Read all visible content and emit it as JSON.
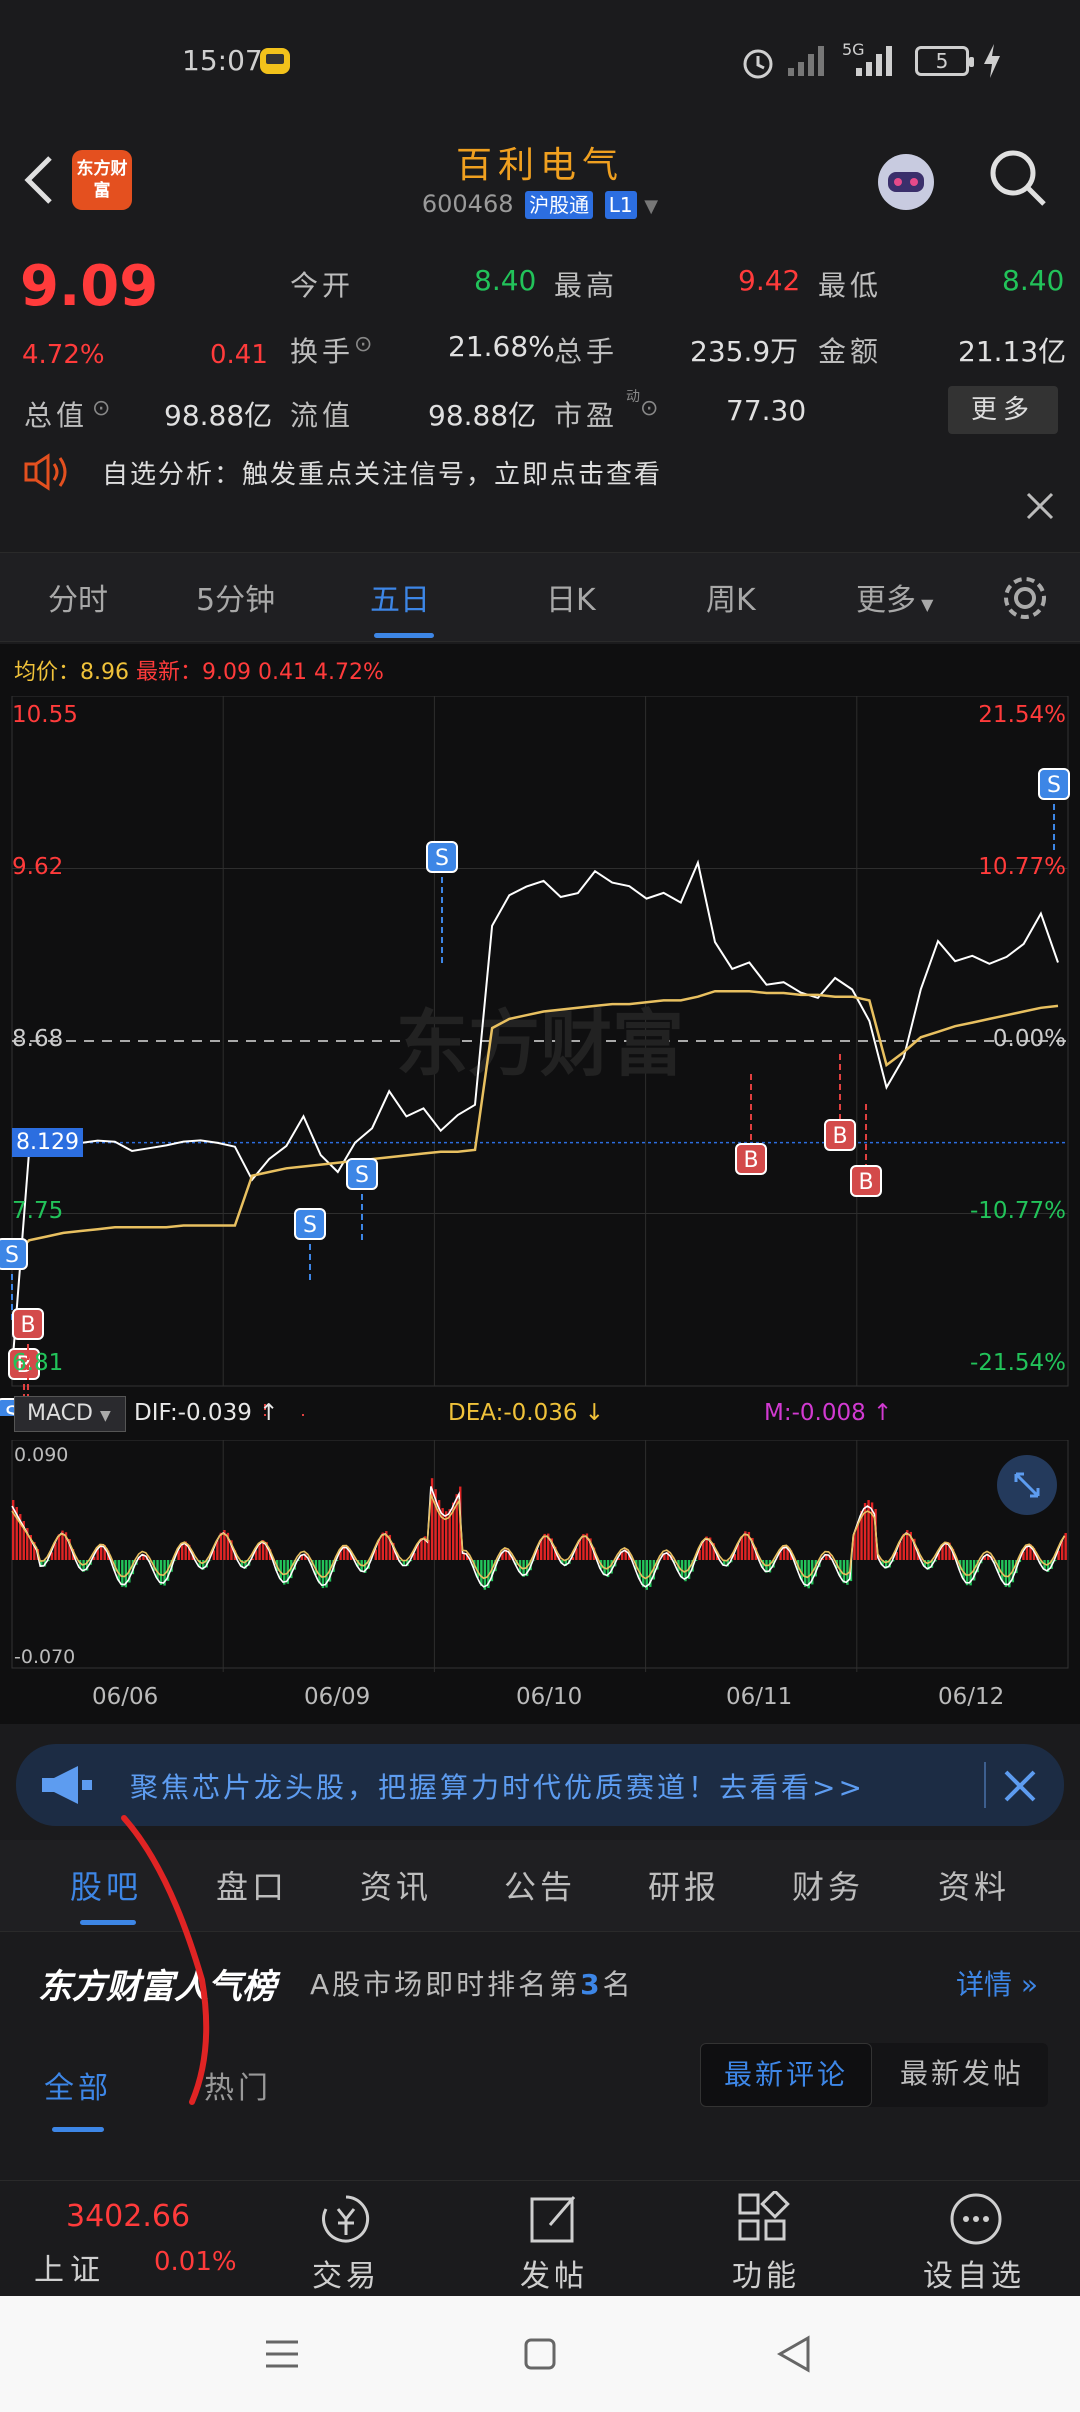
{
  "status_bar": {
    "time": "15:07",
    "network": "5G",
    "battery": "5"
  },
  "header": {
    "logo_text": "东方财富",
    "stock_name": "百利电气",
    "stock_code": "600468",
    "tag_hgt": "沪股通",
    "tag_level": "L1"
  },
  "quote": {
    "price": "9.09",
    "change_pct": "4.72%",
    "change_amt": "0.41",
    "open_label": "今开",
    "open_value": "8.40",
    "high_label": "最高",
    "high_value": "9.42",
    "low_label": "最低",
    "low_value": "8.40",
    "turnover_label": "换手",
    "turnover_value": "21.68%",
    "volume_label": "总手",
    "volume_value": "235.9万",
    "amount_label": "金额",
    "amount_value": "21.13亿",
    "mktcap_label": "总值",
    "mktcap_value": "98.88亿",
    "float_label": "流值",
    "float_value": "98.88亿",
    "pe_label": "市盈",
    "pe_sup": "动",
    "pe_value": "77.30",
    "more_label": "更多"
  },
  "notice": {
    "text": "自选分析：触发重点关注信号，立即点击查看"
  },
  "chart_tabs": [
    "分时",
    "5分钟",
    "五日",
    "日K",
    "周K",
    "更多"
  ],
  "chart_tabs_active": "五日",
  "chart_header": {
    "avg_label": "均价",
    "avg_value": "8.96",
    "latest_label": "最新",
    "latest_value": "9.09",
    "latest_chg": "0.41",
    "latest_pct": "4.72%"
  },
  "macd": {
    "indicator": "MACD",
    "dif": "DIF:-0.039 ↑",
    "dea": "DEA:-0.036 ↓",
    "m": "M:-0.008 ↑",
    "top_label": "0.090",
    "bottom_label": "-0.070"
  },
  "chart_data": {
    "type": "line",
    "title": "",
    "x_days": [
      "06/06",
      "06/09",
      "06/10",
      "06/11",
      "06/12"
    ],
    "y_left_ticks": [
      "10.55",
      "9.62",
      "8.68",
      "7.75",
      "6.81"
    ],
    "y_right_ticks": [
      "21.54%",
      "10.77%",
      "0.00%",
      "-10.77%",
      "-21.54%"
    ],
    "ylim": [
      6.81,
      10.55
    ],
    "prev_close": 8.68,
    "marker_price": "8.129",
    "series": [
      {
        "values": [
          6.9,
          8.1,
          8.11,
          8.12,
          8.11,
          8.12,
          8.13,
          8.1,
          8.12,
          8.12,
          8.12,
          8.12,
          8.12,
          8.12,
          7.95,
          8.05,
          8.1,
          8.25,
          8.05,
          7.98,
          8.15,
          8.22,
          8.4,
          8.25,
          8.3,
          8.2,
          8.3,
          8.35,
          9.3,
          9.45,
          9.5,
          9.55,
          9.48,
          9.5,
          9.6,
          9.52,
          9.5,
          9.45,
          9.5,
          9.45,
          9.65,
          9.2,
          9.05,
          9.1,
          9.0,
          9.02,
          8.95,
          8.9,
          9.0,
          8.95,
          8.8,
          8.45,
          8.6,
          8.95,
          9.2,
          9.1,
          9.15,
          9.12,
          9.15,
          9.2,
          9.35,
          9.09
        ]
      },
      {
        "values": [
          7.5,
          7.6,
          7.62,
          7.64,
          7.65,
          7.66,
          7.67,
          7.67,
          7.67,
          7.67,
          7.68,
          7.68,
          7.68,
          7.68,
          7.95,
          7.97,
          7.99,
          8.0,
          8.01,
          8.02,
          8.03,
          8.04,
          8.05,
          8.06,
          8.07,
          8.08,
          8.08,
          8.09,
          8.75,
          8.8,
          8.82,
          8.84,
          8.85,
          8.86,
          8.87,
          8.88,
          8.88,
          8.89,
          8.9,
          8.9,
          8.92,
          8.95,
          8.95,
          8.95,
          8.94,
          8.94,
          8.93,
          8.93,
          8.92,
          8.92,
          8.9,
          8.55,
          8.62,
          8.7,
          8.73,
          8.76,
          8.78,
          8.8,
          8.82,
          8.84,
          8.86,
          8.87
        ]
      }
    ],
    "signals": [
      {
        "type": "S",
        "day": "06/06"
      },
      {
        "type": "B",
        "day": "06/06"
      },
      {
        "type": "S",
        "day": "06/06"
      },
      {
        "type": "B",
        "day": "06/06"
      },
      {
        "type": "B",
        "day": "06/09"
      },
      {
        "type": "B",
        "day": "06/09"
      },
      {
        "type": "S",
        "day": "06/09"
      },
      {
        "type": "S",
        "day": "06/09"
      },
      {
        "type": "S",
        "day": "06/10"
      },
      {
        "type": "B",
        "day": "06/11"
      },
      {
        "type": "B",
        "day": "06/11"
      },
      {
        "type": "B",
        "day": "06/11"
      },
      {
        "type": "S",
        "day": "06/12"
      }
    ],
    "watermark": "东方财富"
  },
  "promo": {
    "text": "聚焦芯片龙头股，把握算力时代优质赛道！去看看>>"
  },
  "bottom_tabs": [
    "股吧",
    "盘口",
    "资讯",
    "公告",
    "研报",
    "财务",
    "资料"
  ],
  "rank": {
    "title": "东方财富人气榜",
    "desc_prefix": "A股市场即时排名第",
    "rank_num": "3",
    "desc_suffix": "名",
    "detail": "详情"
  },
  "filters": {
    "all": "全部",
    "hot": "热门",
    "latest_comment": "最新评论",
    "latest_post": "最新发帖"
  },
  "bottom_bar": {
    "index_value": "3402.66",
    "index_name": "上证",
    "index_pct": "0.01%",
    "trade": "交易",
    "post": "发帖",
    "func": "功能",
    "watch": "设自选"
  }
}
